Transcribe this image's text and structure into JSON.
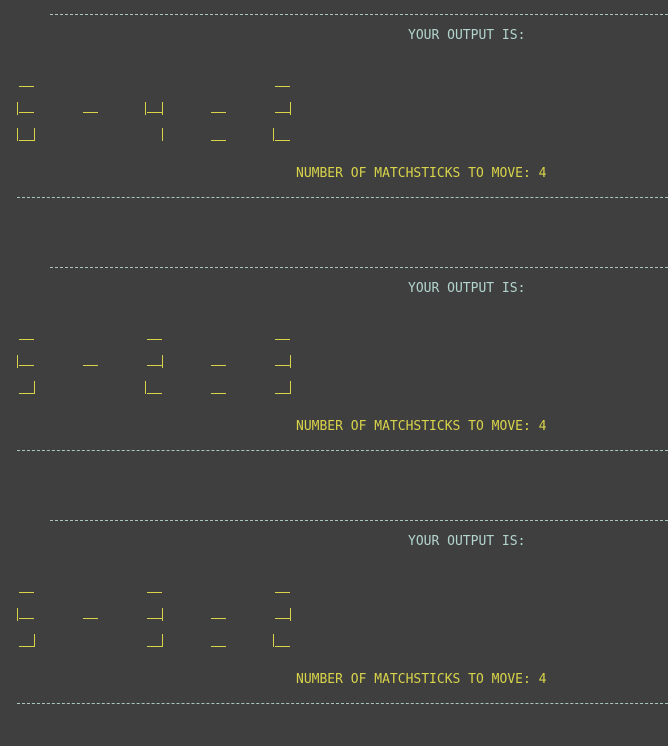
{
  "colors": {
    "background": "#3f3f3f",
    "heading_text": "#b2d4cd",
    "digit_color": "#d8d34a",
    "separator": "#a9c7c0"
  },
  "outputs": [
    {
      "heading": "YOUR OUTPUT IS:",
      "count_label": "NUMBER OF MATCHSTICKS TO MOVE:",
      "count_value": "4",
      "symbols": [
        "6",
        "-",
        "4",
        "=",
        "2"
      ]
    },
    {
      "heading": "YOUR OUTPUT IS:",
      "count_label": "NUMBER OF MATCHSTICKS TO MOVE:",
      "count_value": "4",
      "symbols": [
        "5",
        "-",
        "2",
        "=",
        "3"
      ]
    },
    {
      "heading": "YOUR OUTPUT IS:",
      "count_label": "NUMBER OF MATCHSTICKS TO MOVE:",
      "count_value": "4",
      "symbols": [
        "5",
        "-",
        "3",
        "=",
        "2"
      ]
    }
  ]
}
